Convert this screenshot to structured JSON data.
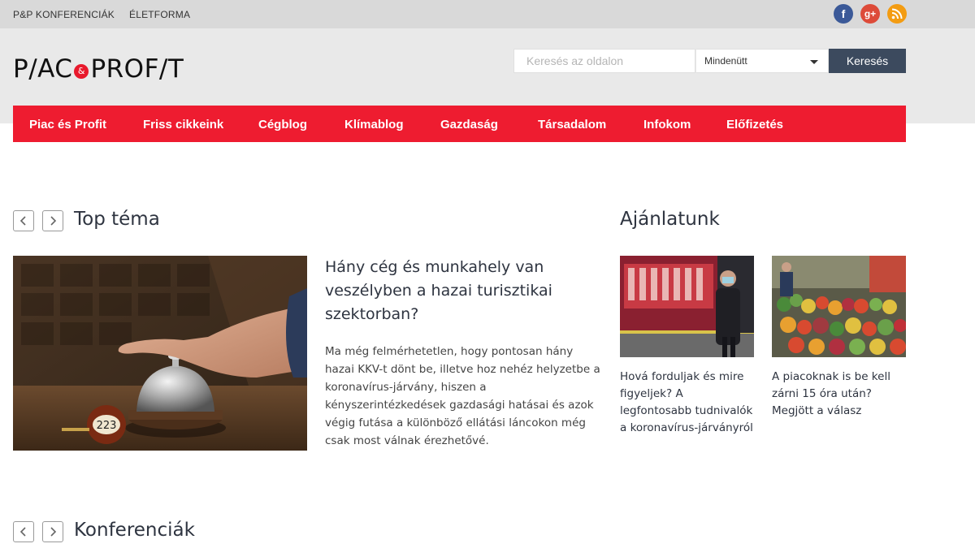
{
  "topbar": {
    "links": [
      "P&P KONFERENCIÁK",
      "ÉLETFORMA"
    ],
    "social": {
      "facebook_glyph": "f",
      "google_glyph": "g+",
      "colors": {
        "facebook": "#3b5998",
        "google": "#dd4b39",
        "rss": "#f39c12"
      }
    }
  },
  "header": {
    "logo_left": "P/AC",
    "logo_amp": "&",
    "logo_right": "PROF/T",
    "search": {
      "placeholder": "Keresés az oldalon",
      "scope": "Mindenütt",
      "button": "Keresés"
    }
  },
  "nav": {
    "accent": "#ee1c30",
    "items": [
      "Piac és Profit",
      "Friss cikkeink",
      "Cégblog",
      "Klímablog",
      "Gazdaság",
      "Társadalom",
      "Infokom",
      "Előfizetés"
    ]
  },
  "top_tema": {
    "title": "Top téma",
    "article": {
      "title": "Hány cég és munkahely van veszélyben a hazai turisztikai szektorban?",
      "lead": "Ma még felmérhetetlen, hogy pontosan hány hazai KKV-t dönt be, illetve hoz nehéz helyzetbe a koronavírus-járvány, hiszen a kényszerintézkedések gazdasági hatásai és azok végig futása a különböző ellátási láncokon még csak most válnak érezhetővé.",
      "tag_number": "223"
    }
  },
  "ajanlatunk": {
    "title": "Ajánlatunk",
    "items": [
      {
        "title": "Hová forduljak és mire figyeljek? A legfontosabb tudnivalók a koronavírus-járványról"
      },
      {
        "title": "A piacoknak is be kell zárni 15 óra után? Megjött a válasz"
      }
    ]
  },
  "konferenciak": {
    "title": "Konferenciák"
  }
}
